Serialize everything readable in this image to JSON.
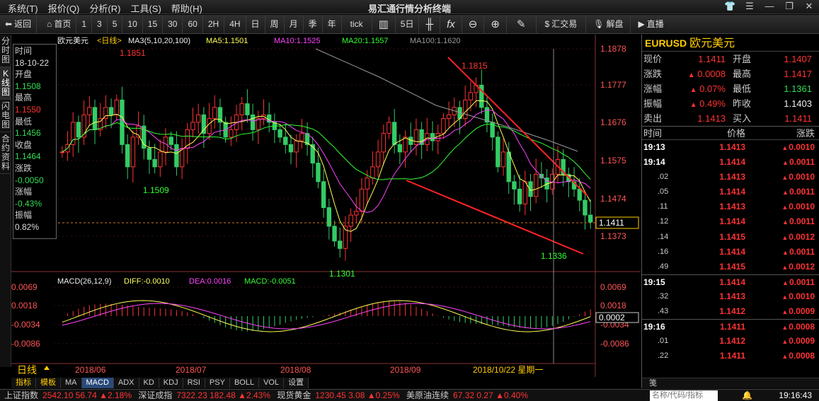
{
  "app": {
    "title": "易汇通行情分析终端",
    "menus": [
      "系统(T)",
      "报价(Q)",
      "分析(R)",
      "工具(S)",
      "帮助(H)"
    ]
  },
  "toolbar": {
    "items": [
      "返回",
      "首页",
      "1",
      "3",
      "5",
      "10",
      "15",
      "30",
      "60",
      "2H",
      "4H",
      "日",
      "周",
      "月",
      "季",
      "年",
      "tick",
      "5日",
      "汇交易",
      "解盘",
      "直播"
    ]
  },
  "lefttabs": [
    "分时图",
    "K线图",
    "闪电图",
    "合约资料"
  ],
  "chart": {
    "ma_header": {
      "name": "欧元美元",
      "period": "<日线>",
      "ma": "MA3(5,10,20,100)",
      "ma5": "MA5:1.1501",
      "ma10": "MA10:1.1525",
      "ma20": "MA20:1.1557",
      "ma100": "MA100:1.1620"
    },
    "price_ticks": [
      "1.1878",
      "1.1777",
      "1.1676",
      "1.1575",
      "1.1474",
      "1.1373"
    ],
    "current_price": "1.1411",
    "annotations": {
      "high1": "1.1851",
      "low1": "1.1509",
      "low2": "1.1301",
      "high2": "1.1815",
      "low3": "1.1336"
    },
    "macd_header": {
      "name": "MACD(26,12,9)",
      "diff": "DIFF:-0.0010",
      "dea": "DEA:0.0016",
      "macd": "MACD:-0.0051"
    },
    "macd_ticks": [
      "0.0069",
      "0.0018",
      "-0.0034",
      "-0.0086"
    ],
    "macd_current": "0.0002",
    "dates": [
      "2018/06",
      "2018/07",
      "2018/08",
      "2018/09"
    ],
    "cursor_date": "2018/10/22 星期一",
    "period_label": "日线"
  },
  "infobox": {
    "time_label": "时间",
    "time": "18-10-22",
    "open_label": "开盘",
    "open": "1.1508",
    "high_label": "最高",
    "high": "1.1550",
    "low_label": "最低",
    "low": "1.1456",
    "close_label": "收盘",
    "close": "1.1464",
    "change_label": "涨跌",
    "change": "-0.0050",
    "pct_label": "涨幅",
    "pct": "-0.43%",
    "amp_label": "振幅",
    "amp": "0.82%"
  },
  "indicator_tabs": [
    "指标",
    "模板",
    "MA",
    "MACD",
    "ADX",
    "KD",
    "KDJ",
    "RSI",
    "PSY",
    "BOLL",
    "VOL",
    "设置"
  ],
  "quote": {
    "code": "EURUSD",
    "name": "欧元美元",
    "rows": [
      {
        "l1": "现价",
        "v1": "1.1411",
        "l2": "开盘",
        "v2": "1.1407"
      },
      {
        "l1": "涨跌",
        "v1": "0.0008",
        "l2": "最高",
        "v2": "1.1417"
      },
      {
        "l1": "涨幅",
        "v1": "0.07%",
        "l2": "最低",
        "v2": "1.1361"
      },
      {
        "l1": "振幅",
        "v1": "0.49%",
        "l2": "昨收",
        "v2": "1.1403"
      },
      {
        "l1": "卖出",
        "v1": "1.1413",
        "l2": "买入",
        "v2": "1.1411"
      }
    ],
    "tick_header": {
      "time": "时间",
      "price": "价格",
      "change": "涨跌"
    },
    "ticks": [
      {
        "t": "19:13",
        "p": "1.1413",
        "c": "0.0010"
      },
      {
        "t": "19:14",
        "p": "1.1414",
        "c": "0.0011"
      },
      {
        "t": ".02",
        "p": "1.1413",
        "c": "0.0010"
      },
      {
        "t": ".05",
        "p": "1.1414",
        "c": "0.0011"
      },
      {
        "t": ".11",
        "p": "1.1413",
        "c": "0.0010"
      },
      {
        "t": ".12",
        "p": "1.1414",
        "c": "0.0011"
      },
      {
        "t": ".14",
        "p": "1.1415",
        "c": "0.0012"
      },
      {
        "t": ".16",
        "p": "1.1414",
        "c": "0.0011"
      },
      {
        "t": ".49",
        "p": "1.1415",
        "c": "0.0012"
      },
      {
        "t": "19:15",
        "p": "1.1414",
        "c": "0.0011"
      },
      {
        "t": ".32",
        "p": "1.1413",
        "c": "0.0010"
      },
      {
        "t": ".43",
        "p": "1.1412",
        "c": "0.0009"
      },
      {
        "t": "19:16",
        "p": "1.1411",
        "c": "0.0008"
      },
      {
        "t": ".01",
        "p": "1.1412",
        "c": "0.0009"
      },
      {
        "t": ".22",
        "p": "1.1411",
        "c": "0.0008"
      }
    ],
    "bottom_tab": "笺"
  },
  "statusbar": {
    "items": [
      {
        "l": "上证指数",
        "v": "2542.10  56.74 ▲2.18%"
      },
      {
        "l": "深证成指",
        "v": "7322.23  182.48 ▲2.43%"
      },
      {
        "l": "现货黄金",
        "v": "1230.45  3.08 ▲0.25%"
      },
      {
        "l": "美原油连续",
        "v": "67.32  0.27 ▲0.40%"
      }
    ],
    "search_placeholder": "名称/代码/指标",
    "clock": "19:16:43"
  }
}
